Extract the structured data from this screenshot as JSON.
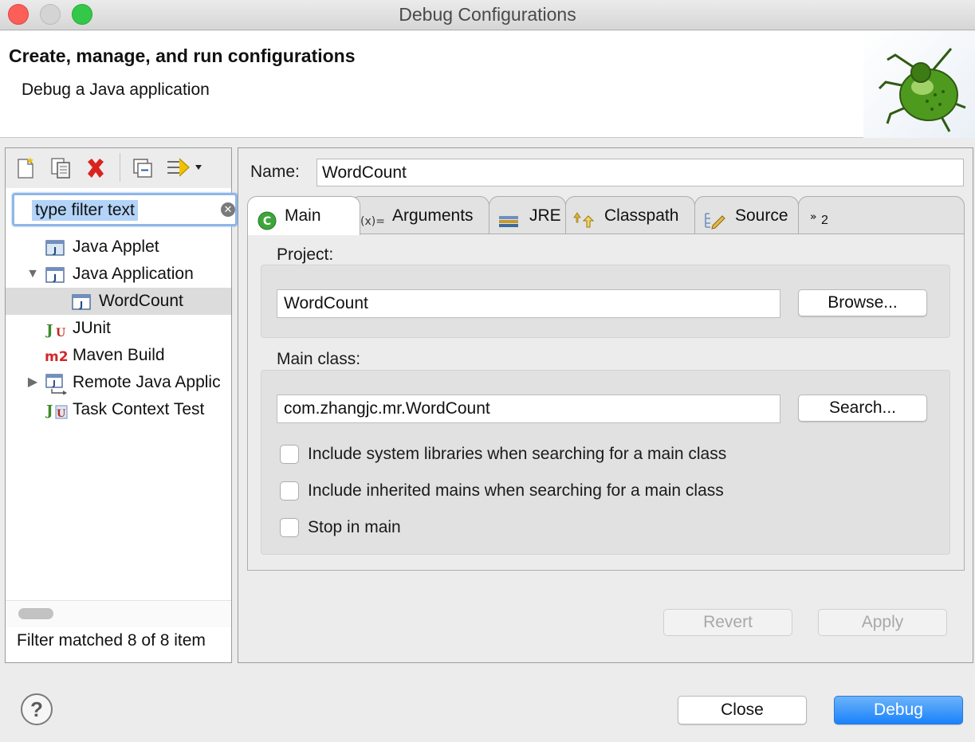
{
  "window": {
    "title": "Debug Configurations"
  },
  "banner": {
    "title": "Create, manage, and run configurations",
    "description": "Debug a Java application"
  },
  "left": {
    "filter_text": "type filter text",
    "tree": [
      {
        "label": "Java Applet"
      },
      {
        "label": "Java Application"
      },
      {
        "label": "WordCount"
      },
      {
        "label": "JUnit"
      },
      {
        "label": "Maven Build"
      },
      {
        "label": "Remote Java Applic"
      },
      {
        "label": "Task Context Test"
      }
    ],
    "status": "Filter matched 8 of 8 item"
  },
  "right": {
    "name_label": "Name:",
    "name_value": "WordCount",
    "tabs": [
      {
        "label": "Main"
      },
      {
        "label": "Arguments"
      },
      {
        "label": "JRE"
      },
      {
        "label": "Classpath"
      },
      {
        "label": "Source"
      },
      {
        "label": "2"
      }
    ],
    "project_label": "Project:",
    "project_value": "WordCount",
    "browse_label": "Browse...",
    "main_class_label": "Main class:",
    "main_class_value": "com.zhangjc.mr.WordCount",
    "search_label": "Search...",
    "checkboxes": [
      {
        "label": "Include system libraries when searching for a main class",
        "checked": false
      },
      {
        "label": "Include inherited mains when searching for a main class",
        "checked": false
      },
      {
        "label": "Stop in main",
        "checked": false
      }
    ],
    "revert_label": "Revert",
    "apply_label": "Apply"
  },
  "footer": {
    "help_glyph": "?",
    "close_label": "Close",
    "debug_label": "Debug"
  },
  "colors": {
    "accent": "#1a82fb",
    "selection": "#b3d3f8"
  }
}
